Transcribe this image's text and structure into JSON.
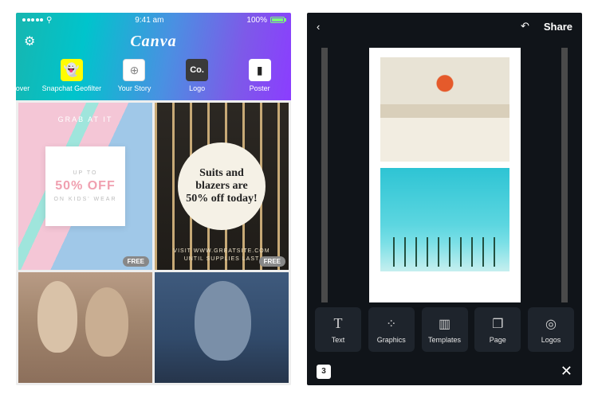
{
  "status": {
    "time": "9:41 am",
    "battery_pct": "100%"
  },
  "brand": "Canva",
  "categories": [
    {
      "label": "Cover",
      "name": "cat-cover",
      "icon": ""
    },
    {
      "label": "Snapchat Geofilter",
      "name": "cat-snapchat",
      "icon": "👻"
    },
    {
      "label": "Your Story",
      "name": "cat-story",
      "icon": "⊕"
    },
    {
      "label": "Logo",
      "name": "cat-logo",
      "icon": "Co."
    },
    {
      "label": "Poster",
      "name": "cat-poster",
      "icon": "▮"
    }
  ],
  "templates": {
    "t1": {
      "grab": "GRAB AT IT",
      "upto": "UP TO",
      "pct": "50% OFF",
      "on": "ON KIDS' WEAR",
      "badge": "FREE"
    },
    "t2": {
      "headline": "Suits and blazers are 50% off today!",
      "foot1": "VISIT WWW.GREATSITE.COM",
      "foot2": "UNTIL SUPPLIES LAST",
      "badge": "FREE"
    }
  },
  "editor": {
    "share": "Share",
    "tools": [
      {
        "label": "Text",
        "name": "tool-text",
        "icon": "T"
      },
      {
        "label": "Graphics",
        "name": "tool-graphics",
        "icon": "⁘"
      },
      {
        "label": "Templates",
        "name": "tool-templates",
        "icon": "▥"
      },
      {
        "label": "Page",
        "name": "tool-page",
        "icon": "❐"
      },
      {
        "label": "Logos",
        "name": "tool-logos",
        "icon": "◎"
      }
    ],
    "page_count": "3"
  }
}
